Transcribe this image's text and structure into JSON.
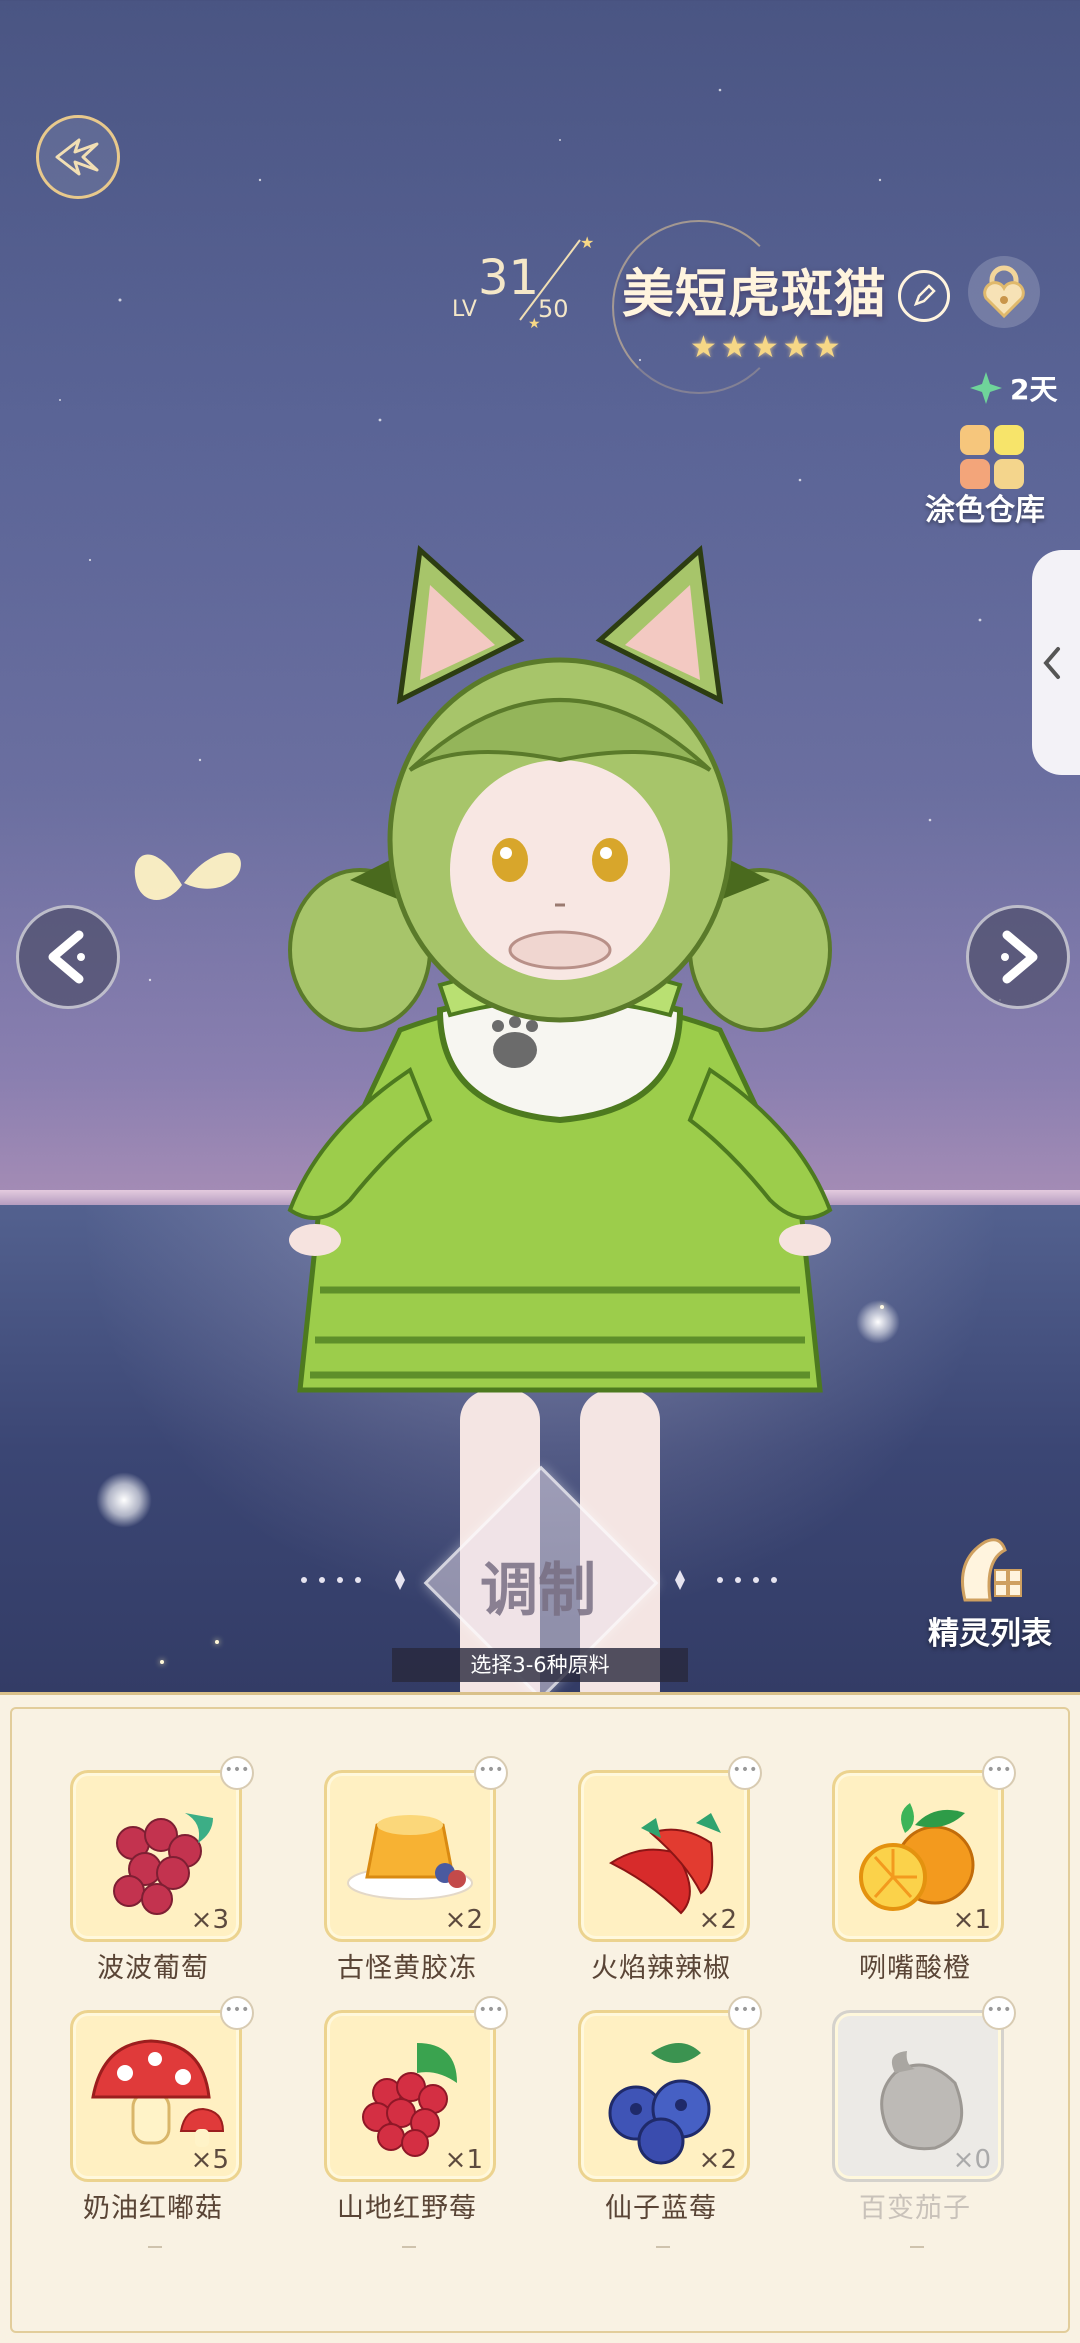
{
  "header": {
    "level_label": "LV",
    "level_current": "31",
    "level_max": "50",
    "pet_name": "美短虎斑猫",
    "star_count": 5,
    "days_left": "2天",
    "color_storage_label": "涂色仓库"
  },
  "craft": {
    "button_label": "调制",
    "hint": "选择3-6种原料"
  },
  "pet_list_label": "精灵列表",
  "ingredients": [
    {
      "name": "波波葡萄",
      "count": "×3",
      "icon": "grape-icon",
      "available": true
    },
    {
      "name": "古怪黄胶冻",
      "count": "×2",
      "icon": "jelly-pudding-icon",
      "available": true
    },
    {
      "name": "火焰辣辣椒",
      "count": "×2",
      "icon": "chili-pepper-icon",
      "available": true
    },
    {
      "name": "咧嘴酸橙",
      "count": "×1",
      "icon": "orange-icon",
      "available": true
    },
    {
      "name": "奶油红嘟菇",
      "count": "×5",
      "icon": "mushroom-icon",
      "available": true
    },
    {
      "name": "山地红野莓",
      "count": "×1",
      "icon": "raspberry-icon",
      "available": true
    },
    {
      "name": "仙子蓝莓",
      "count": "×2",
      "icon": "blueberry-icon",
      "available": true
    },
    {
      "name": "百变茄子",
      "count": "×0",
      "icon": "eggplant-icon",
      "available": false
    }
  ],
  "colors": {
    "accent_gold": "#e8c98c",
    "panel_bg": "#f9f2e3",
    "card_bg": "#fff0c2",
    "dress_green": "#9ccd4b"
  }
}
